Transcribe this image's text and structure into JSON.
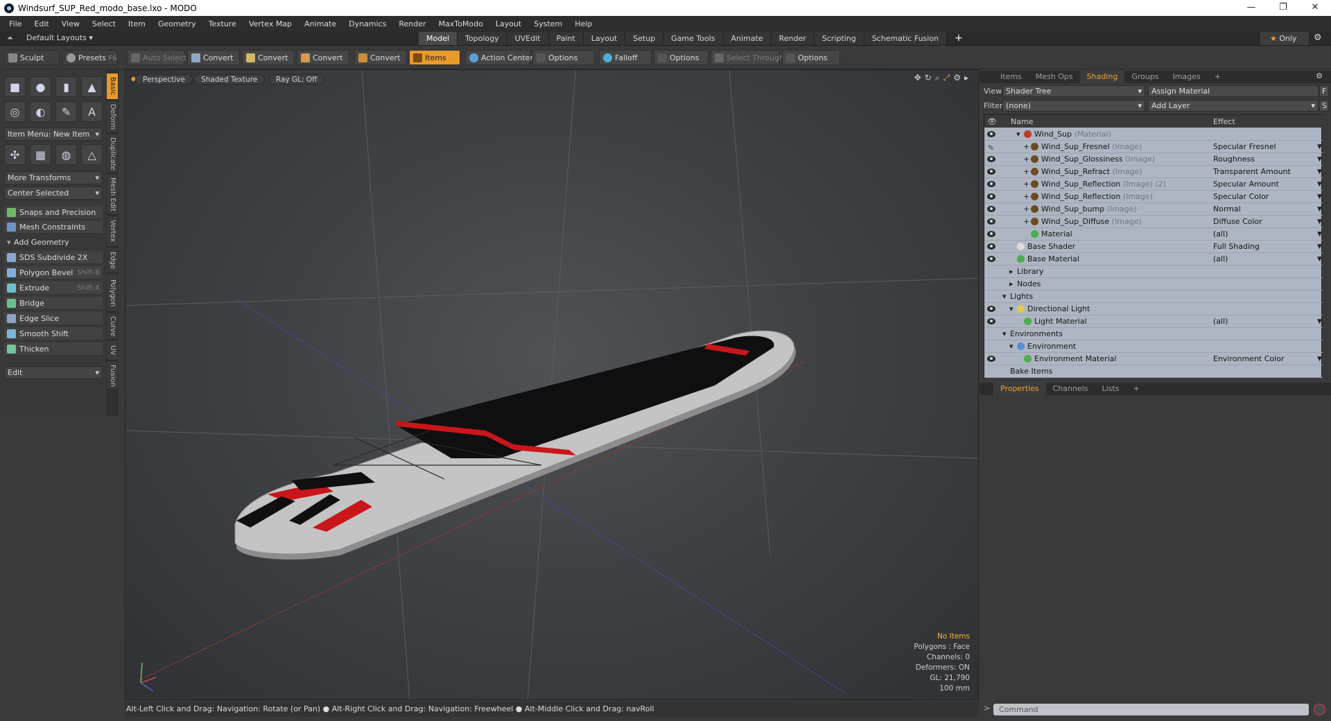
{
  "window": {
    "title": "Windsurf_SUP_Red_modo_base.lxo - MODO",
    "controls": [
      "—",
      "❐",
      "✕"
    ]
  },
  "menu": [
    "File",
    "Edit",
    "View",
    "Select",
    "Item",
    "Geometry",
    "Texture",
    "Vertex Map",
    "Animate",
    "Dynamics",
    "Render",
    "MaxToModo",
    "Layout",
    "System",
    "Help"
  ],
  "layouts": {
    "label": "Default Layouts",
    "tabs": [
      "Model",
      "Topology",
      "UVEdit",
      "Paint",
      "Layout",
      "Setup",
      "Game Tools",
      "Animate",
      "Render",
      "Scripting",
      "Schematic Fusion"
    ],
    "active": "Model",
    "add": "+",
    "only": "Only"
  },
  "toolbar": {
    "sculpt": "Sculpt",
    "presets": "Presets",
    "presets_key": "F6",
    "auto_select": "Auto Select",
    "convert": "Convert",
    "items": "Items",
    "action_center": "Action Center",
    "options": "Options",
    "falloff": "Falloff",
    "select_through": "Select Through"
  },
  "left": {
    "item_menu": "Item Menu: New Item",
    "more_transforms": "More Transforms",
    "center_selected": "Center Selected",
    "snaps": "Snaps and Precision",
    "mesh_constraints": "Mesh Constraints",
    "add_geometry": "Add Geometry",
    "tools": [
      {
        "label": "SDS Subdivide 2X",
        "key": ""
      },
      {
        "label": "Polygon Bevel",
        "key": "Shift-B"
      },
      {
        "label": "Extrude",
        "key": "Shift-X"
      },
      {
        "label": "Bridge",
        "key": ""
      },
      {
        "label": "Edge Slice",
        "key": ""
      },
      {
        "label": "Smooth Shift",
        "key": ""
      },
      {
        "label": "Thicken",
        "key": ""
      }
    ],
    "edit": "Edit",
    "vtabs": [
      "Basic",
      "Deform",
      "Duplicate",
      "Mesh Edit",
      "Vertex",
      "Edge",
      "Polygon",
      "Curve",
      "UV",
      "Fusion"
    ]
  },
  "viewport": {
    "view": "Perspective",
    "shading": "Shaded Texture",
    "raygl": "Ray GL: Off",
    "hud": {
      "items": "No Items",
      "polygons": "Polygons : Face",
      "channels": "Channels: 0",
      "deformers": "Deformers: ON",
      "gl": "GL: 21,790",
      "units": "100 mm"
    }
  },
  "status": "Alt-Left Click and Drag: Navigation: Rotate (or Pan) ● Alt-Right Click and Drag: Navigation: Freewheel ● Alt-Middle Click and Drag: navRoll",
  "right": {
    "tabs": [
      "Items",
      "Mesh Ops",
      "Shading",
      "Groups",
      "Images",
      "+"
    ],
    "active_tab": "Shading",
    "view_label": "View",
    "view_value": "Shader Tree",
    "assign": "Assign Material",
    "filter_label": "Filter",
    "filter_value": "(none)",
    "add_layer": "Add Layer",
    "f_btn": "F",
    "s_btn": "S",
    "columns": {
      "name": "Name",
      "effect": "Effect"
    },
    "rows": [
      {
        "name": "Wind_Sup",
        "type": "(Material)",
        "effect": "",
        "indent": 3,
        "eye": true,
        "color": "#c0392b",
        "expand": "▾"
      },
      {
        "name": "Wind_Sup_Fresnel",
        "type": "(Image)",
        "effect": "Specular Fresnel",
        "indent": 4,
        "eye": false,
        "color": "#6b4b1f",
        "expand": "+"
      },
      {
        "name": "Wind_Sup_Glossiness",
        "type": "(Image)",
        "effect": "Roughness",
        "indent": 4,
        "eye": true,
        "color": "#6b4b1f",
        "expand": "+"
      },
      {
        "name": "Wind_Sup_Refract",
        "type": "(Image)",
        "effect": "Transparent Amount",
        "indent": 4,
        "eye": true,
        "color": "#6b4b1f",
        "expand": "+"
      },
      {
        "name": "Wind_Sup_Reflection",
        "type": "(Image) (2)",
        "effect": "Specular Amount",
        "indent": 4,
        "eye": true,
        "color": "#6b4b1f",
        "expand": "+"
      },
      {
        "name": "Wind_Sup_Reflection",
        "type": "(Image)",
        "effect": "Specular Color",
        "indent": 4,
        "eye": true,
        "color": "#6b4b1f",
        "expand": "+"
      },
      {
        "name": "Wind_Sup_bump",
        "type": "(Image)",
        "effect": "Normal",
        "indent": 4,
        "eye": true,
        "color": "#6b4b1f",
        "expand": "+"
      },
      {
        "name": "Wind_Sup_Diffuse",
        "type": "(Image)",
        "effect": "Diffuse Color",
        "indent": 4,
        "eye": true,
        "color": "#6b4b1f",
        "expand": "+"
      },
      {
        "name": "Material",
        "type": "",
        "effect": "(all)",
        "indent": 4,
        "eye": true,
        "color": "#4caf50",
        "expand": ""
      },
      {
        "name": "Base Shader",
        "type": "",
        "effect": "Full Shading",
        "indent": 2,
        "eye": true,
        "color": "#dddddd",
        "expand": ""
      },
      {
        "name": "Base Material",
        "type": "",
        "effect": "(all)",
        "indent": 2,
        "eye": true,
        "color": "#4caf50",
        "expand": ""
      },
      {
        "name": "Library",
        "type": "",
        "effect": "",
        "indent": 2,
        "eye": false,
        "color": "",
        "expand": "▸"
      },
      {
        "name": "Nodes",
        "type": "",
        "effect": "",
        "indent": 2,
        "eye": false,
        "color": "",
        "expand": "▸"
      },
      {
        "name": "Lights",
        "type": "",
        "effect": "",
        "indent": 1,
        "eye": false,
        "color": "",
        "expand": "▾"
      },
      {
        "name": "Directional Light",
        "type": "",
        "effect": "",
        "indent": 2,
        "eye": true,
        "color": "#e8c84a",
        "expand": "▾"
      },
      {
        "name": "Light Material",
        "type": "",
        "effect": "(all)",
        "indent": 3,
        "eye": true,
        "color": "#4caf50",
        "expand": ""
      },
      {
        "name": "Environments",
        "type": "",
        "effect": "",
        "indent": 1,
        "eye": false,
        "color": "",
        "expand": "▾"
      },
      {
        "name": "Environment",
        "type": "",
        "effect": "",
        "indent": 2,
        "eye": false,
        "color": "#5a8fd8",
        "expand": "▾"
      },
      {
        "name": "Environment Material",
        "type": "",
        "effect": "Environment Color",
        "indent": 3,
        "eye": true,
        "color": "#4caf50",
        "expand": ""
      },
      {
        "name": "Bake Items",
        "type": "",
        "effect": "",
        "indent": 1,
        "eye": false,
        "color": "",
        "expand": ""
      }
    ],
    "bottom_tabs": [
      "Properties",
      "Channels",
      "Lists",
      "+"
    ],
    "bottom_active": "Properties",
    "command_placeholder": "Command"
  },
  "colors": {
    "accent": "#e89a2b",
    "board_red": "#c9161b",
    "board_black": "#0f0f10",
    "board_gray": "#bfbfbf"
  }
}
